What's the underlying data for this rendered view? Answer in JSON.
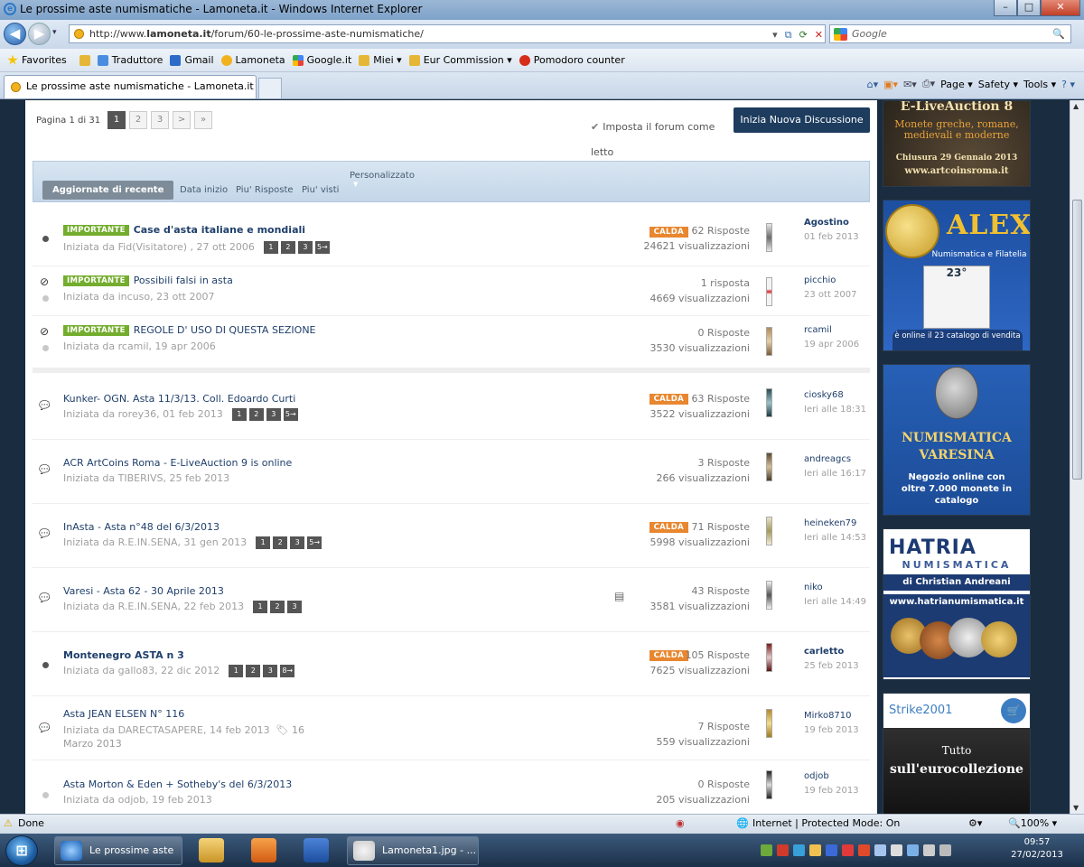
{
  "window": {
    "title": "Le prossime aste numismatiche - Lamoneta.it - Windows Internet Explorer",
    "min": "–",
    "max": "□",
    "close": "✕"
  },
  "address": {
    "url_prefix": "http://www.",
    "url_domain": "lamoneta.it",
    "url_path": "/forum/60-le-prossime-aste-numismatiche/",
    "search_placeholder": "Google",
    "search_icon": "🔍"
  },
  "favorites": {
    "favorites_label": "Favorites",
    "items": [
      {
        "label": "Traduttore",
        "color": "#4a8de0"
      },
      {
        "label": "Gmail",
        "color": "#2d6bc8"
      },
      {
        "label": "Lamoneta",
        "color": "#f2b21e"
      },
      {
        "label": "Google.it",
        "color": "#3f85f4"
      },
      {
        "label": "Miei ▾",
        "color": "#e6b737"
      },
      {
        "label": "Eur Commission ▾",
        "color": "#e6b737"
      },
      {
        "label": "Pomodoro counter",
        "color": "#d62c1a"
      }
    ]
  },
  "tab": {
    "label": "Le prossime aste numismatiche - Lamoneta.it"
  },
  "commands": {
    "page": "Page ▾",
    "safety": "Safety ▾",
    "tools": "Tools ▾",
    "help": "? ▾"
  },
  "pager": {
    "label": "Pagina 1 di 31",
    "pages": [
      "1",
      "2",
      "3",
      ">",
      "»"
    ]
  },
  "markread": "Imposta il forum come letto",
  "newtopic": "Inizia Nuova Discussione",
  "filter": {
    "active": "Aggiornate di recente",
    "options": [
      "Data inizio",
      "Piu' Risposte",
      "Piu' visti"
    ],
    "custom": "Personalizzato"
  },
  "badges": {
    "important": "IMPORTANTE",
    "hot": "CALDA"
  },
  "topics": [
    {
      "title": "Case d'asta italiane e mondiali",
      "bold": true,
      "important": true,
      "hot": true,
      "started": "Iniziata da Fid(Visitatore) , 27 ott 2006",
      "pages": [
        "1",
        "2",
        "3",
        "5→"
      ],
      "replies": "62 Risposte",
      "views": "24621 visualizzazioni",
      "user": "Agostino",
      "date": "01 feb 2013"
    },
    {
      "title": "Possibili falsi in asta",
      "bold": false,
      "important": true,
      "hot": false,
      "started": "Iniziata da incuso, 23 ott 2007",
      "pages": [],
      "replies": "1 risposta",
      "views": "4669 visualizzazioni",
      "user": "picchio",
      "date": "23 ott 2007"
    },
    {
      "title": "REGOLE D' USO DI QUESTA SEZIONE",
      "bold": false,
      "important": true,
      "hot": false,
      "started": "Iniziata da rcamil, 19 apr 2006",
      "pages": [],
      "replies": "0 Risposte",
      "views": "3530 visualizzazioni",
      "user": "rcamil",
      "date": "19 apr 2006"
    },
    {
      "title": "Kunker- OGN. Asta 11/3/13. Coll. Edoardo Curti",
      "bold": false,
      "important": false,
      "hot": true,
      "started": "Iniziata da rorey36, 01 feb 2013",
      "pages": [
        "1",
        "2",
        "3",
        "5→"
      ],
      "replies": "63 Risposte",
      "views": "3522 visualizzazioni",
      "user": "ciosky68",
      "date": "Ieri alle 18:31"
    },
    {
      "title": "ACR ArtCoins Roma - E-LiveAuction 9 is online",
      "bold": false,
      "important": false,
      "hot": false,
      "started": "Iniziata da TIBERIVS, 25 feb 2013",
      "pages": [],
      "replies": "3 Risposte",
      "views": "266 visualizzazioni",
      "user": "andreagcs",
      "date": "Ieri alle 16:17"
    },
    {
      "title": "InAsta - Asta n°48 del 6/3/2013",
      "bold": false,
      "important": false,
      "hot": true,
      "started": "Iniziata da R.E.IN.SENA, 31 gen 2013",
      "pages": [
        "1",
        "2",
        "3",
        "5→"
      ],
      "replies": "71 Risposte",
      "views": "5998 visualizzazioni",
      "user": "heineken79",
      "date": "Ieri alle 14:53"
    },
    {
      "title": "Varesi - Asta 62 - 30 Aprile 2013",
      "bold": false,
      "important": false,
      "hot": false,
      "started": "Iniziata da R.E.IN.SENA, 22 feb 2013",
      "pages": [
        "1",
        "2",
        "3"
      ],
      "replies": "43 Risposte",
      "views": "3581 visualizzazioni",
      "user": "niko",
      "date": "Ieri alle 14:49"
    },
    {
      "title": "Montenegro ASTA n 3",
      "bold": true,
      "important": false,
      "hot": true,
      "started": "Iniziata da gallo83, 22 dic 2012",
      "pages": [
        "1",
        "2",
        "3",
        "8→"
      ],
      "replies": "105 Risposte",
      "views": "7625 visualizzazioni",
      "user": "carletto",
      "date": "25 feb 2013"
    },
    {
      "title": "Asta JEAN ELSEN N° 116",
      "bold": false,
      "important": false,
      "hot": false,
      "started": "Iniziata da DARECTASAPERE, 14 feb 2013",
      "tag": "16 Marzo 2013",
      "pages": [],
      "replies": "7 Risposte",
      "views": "559 visualizzazioni",
      "user": "Mirko8710",
      "date": "19 feb 2013"
    },
    {
      "title": "Asta Morton & Eden + Sotheby's del 6/3/2013",
      "bold": false,
      "important": false,
      "hot": false,
      "started": "Iniziata da odjob, 19 feb 2013",
      "pages": [],
      "replies": "0 Risposte",
      "views": "205 visualizzazioni",
      "user": "odjob",
      "date": "19 feb 2013"
    }
  ],
  "ads": {
    "ad1": {
      "title": "E-LiveAuction 8",
      "sub": "Monete greche, romane, medievali e moderne",
      "close": "Chiusura 29 Gennaio 2013",
      "url": "www.artcoinsroma.it"
    },
    "ad2": {
      "brand": "ALEX",
      "sub": "Numismatica e Filatelia",
      "n": "23°",
      "promo": "è online il 23 catalogo di vendita"
    },
    "ad3": {
      "title": "NUMISMATICA VARESINA",
      "sub": "Negozio online con oltre 7.000 monete in catalogo"
    },
    "ad4": {
      "title": "HATRIA",
      "sub": "NUMISMATICA",
      "owner": "di Christian Andreani",
      "url": "www.hatrianumismatica.it"
    },
    "ad5": {
      "brand": "Strike2001",
      "l1": "Tutto",
      "l2": "sull'eurocollezione"
    }
  },
  "status": {
    "done": "Done",
    "zone": "Internet | Protected Mode: On",
    "zoom": "100%"
  },
  "taskbar": {
    "ie_task": "Le prossime aste ...",
    "img_task": "Lamoneta1.jpg - ...",
    "time": "09:57",
    "date": "27/02/2013"
  }
}
